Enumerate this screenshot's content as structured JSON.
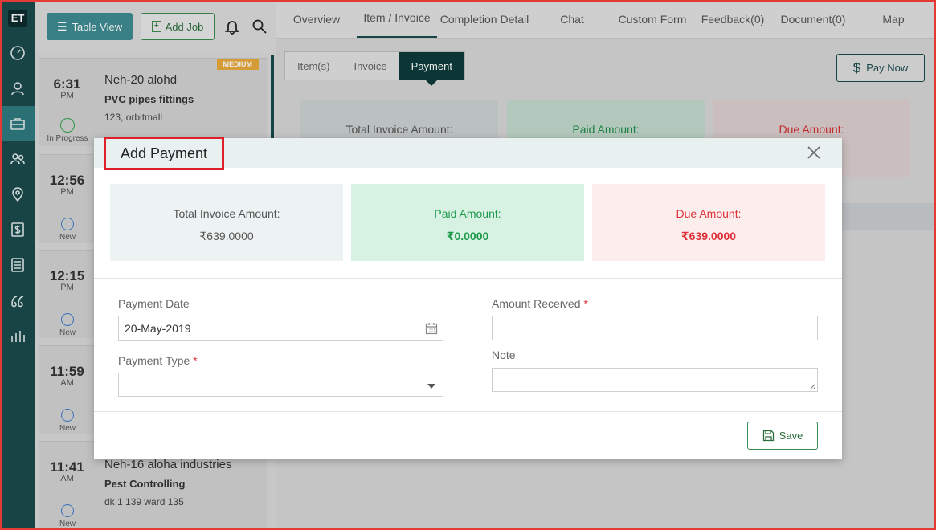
{
  "rail": {
    "logo": "ET",
    "icons": [
      "dashboard-icon",
      "user-icon",
      "briefcase-icon",
      "users-icon",
      "map-pin-icon",
      "dollar-icon",
      "list-icon",
      "quote-icon",
      "bar-chart-icon"
    ],
    "active_index": 2
  },
  "toolbar": {
    "table_view_label": "Table View",
    "add_job_label": "Add Job"
  },
  "jobs": [
    {
      "time": "6:31",
      "ampm": "PM",
      "name": "Neh-20 alohd",
      "service": "PVC pipes fittings",
      "address": "123, orbitmall",
      "status": "In Progress",
      "badge": "MEDIUM"
    },
    {
      "time": "12:56",
      "ampm": "PM",
      "status": "New"
    },
    {
      "time": "12:15",
      "ampm": "PM",
      "status": "New"
    },
    {
      "time": "11:59",
      "ampm": "AM",
      "status": "New"
    },
    {
      "time": "11:41",
      "ampm": "AM",
      "name": "Neh-16 aloha industries",
      "service": "Pest Controlling",
      "address": "dk 1 139 ward 135",
      "status": "New"
    }
  ],
  "main_tabs": [
    "Overview",
    "Item / Invoice",
    "Completion Detail",
    "Chat",
    "Custom Form",
    "Feedback(0)",
    "Document(0)",
    "Map"
  ],
  "sub_tabs": [
    "Item(s)",
    "Invoice",
    "Payment"
  ],
  "pay_now_label": "Pay Now",
  "background_summary": {
    "total_label": "Total Invoice Amount:",
    "paid_label": "Paid Amount:",
    "due_label": "Due Amount:"
  },
  "modal": {
    "title": "Add Payment",
    "summary": {
      "total_label": "Total Invoice Amount:",
      "total_value": "₹639.0000",
      "paid_label": "Paid Amount:",
      "paid_value": "₹0.0000",
      "due_label": "Due Amount:",
      "due_value": "₹639.0000"
    },
    "form": {
      "payment_date_label": "Payment Date",
      "payment_date_value": "20-May-2019",
      "payment_type_label": "Payment Type",
      "payment_type_value": "",
      "amount_received_label": "Amount Received",
      "amount_received_value": "",
      "note_label": "Note",
      "note_value": "",
      "required_mark": "*"
    },
    "save_label": "Save"
  },
  "colors": {
    "rail": "#1c4a4d",
    "accent": "#3d8b91",
    "paid": "#1e9a4c",
    "due": "#e0303a",
    "highlight": "#e01f2c"
  }
}
